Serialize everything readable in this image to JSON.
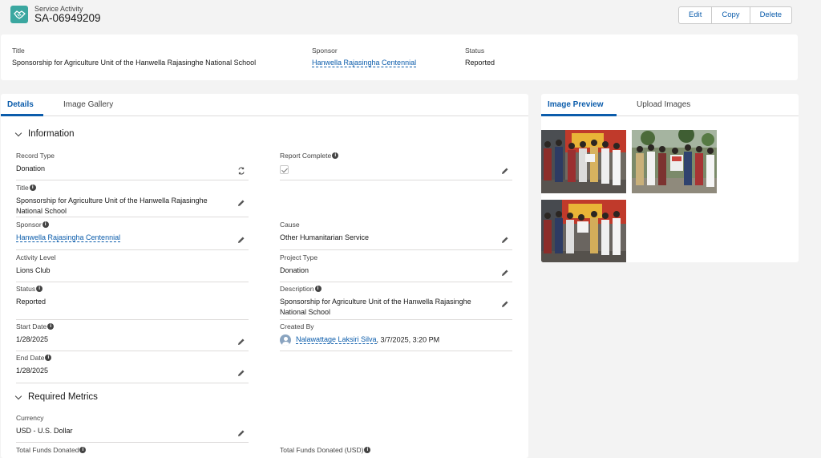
{
  "header": {
    "object_type": "Service Activity",
    "record_name": "SA-06949209",
    "actions": [
      "Edit",
      "Copy",
      "Delete"
    ]
  },
  "highlights": {
    "title_label": "Title",
    "title_value": "Sponsorship for Agriculture Unit of the Hanwella Rajasinghe National School",
    "sponsor_label": "Sponsor",
    "sponsor_value": "Hanwella Rajasingha Centennial",
    "status_label": "Status",
    "status_value": "Reported"
  },
  "left_tabs": [
    "Details",
    "Image Gallery"
  ],
  "sections": {
    "information": "Information",
    "required_metrics": "Required Metrics"
  },
  "fields": {
    "record_type": {
      "label": "Record Type",
      "value": "Donation"
    },
    "report_complete": {
      "label": "Report Complete",
      "checked": true
    },
    "title": {
      "label": "Title",
      "value": "Sponsorship for Agriculture Unit of the Hanwella Rajasinghe National School"
    },
    "sponsor": {
      "label": "Sponsor",
      "value": "Hanwella Rajasingha Centennial"
    },
    "cause": {
      "label": "Cause",
      "value": "Other Humanitarian Service"
    },
    "activity_level": {
      "label": "Activity Level",
      "value": "Lions Club"
    },
    "project_type": {
      "label": "Project Type",
      "value": "Donation"
    },
    "status": {
      "label": "Status",
      "value": "Reported"
    },
    "description": {
      "label": "Description",
      "value": "Sponsorship for Agriculture Unit of the Hanwella Rajasinghe National School"
    },
    "start_date": {
      "label": "Start Date",
      "value": "1/28/2025"
    },
    "created_by": {
      "label": "Created By",
      "user": "Nalawattage Laksiri Silva",
      "timestamp": ", 3/7/2025, 3:20 PM"
    },
    "end_date": {
      "label": "End Date",
      "value": "1/28/2025"
    },
    "currency": {
      "label": "Currency",
      "value": "USD - U.S. Dollar"
    },
    "total_funds_donated": {
      "label": "Total Funds Donated"
    },
    "total_funds_donated_usd": {
      "label": "Total Funds Donated (USD)"
    }
  },
  "right_tabs": [
    "Image Preview",
    "Upload Images"
  ],
  "colors": {
    "brand": "#0b5cab",
    "record_icon": "#3ba7a0",
    "page_bg": "#f3f3f3"
  },
  "icons": {
    "record_icon": "handshake-icon",
    "edit_icon": "pencil-icon",
    "record_type_icon": "change-record-type-icon",
    "info_icon": "info-icon",
    "user_icon": "user-avatar-icon"
  }
}
